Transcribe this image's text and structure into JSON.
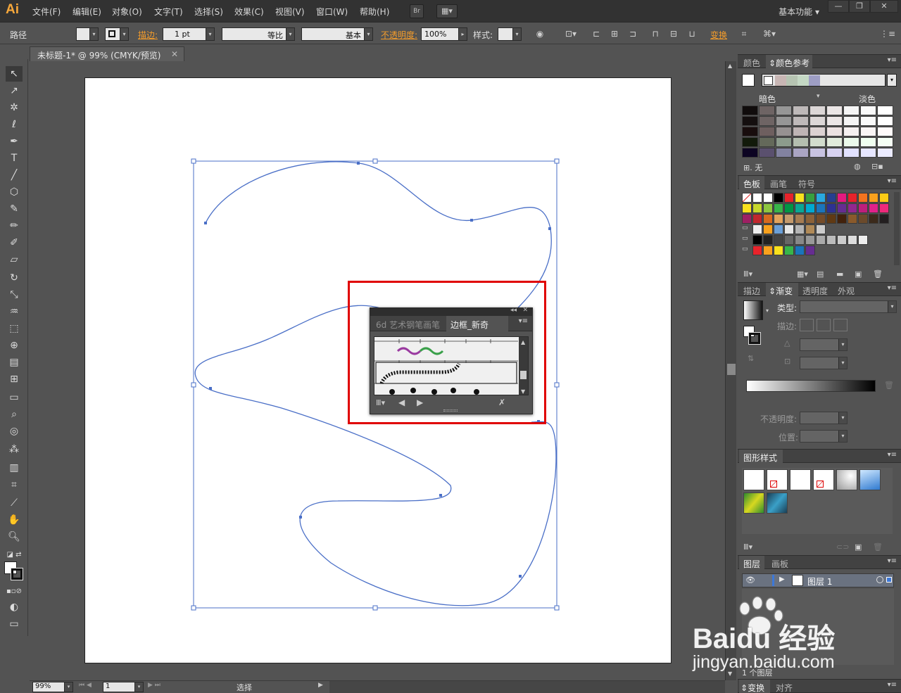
{
  "app": {
    "logo": "Ai"
  },
  "menu": {
    "items": [
      "文件(F)",
      "编辑(E)",
      "对象(O)",
      "文字(T)",
      "选择(S)",
      "效果(C)",
      "视图(V)",
      "窗口(W)",
      "帮助(H)"
    ],
    "bridge_label": "Br",
    "workspace": "基本功能"
  },
  "control_bar": {
    "selection_type": "路径",
    "stroke_label": "描边:",
    "stroke_weight": "1 pt",
    "profile": "等比",
    "brush": "基本",
    "opacity_label": "不透明度:",
    "opacity_value": "100%",
    "style_label": "样式:",
    "transform_label": "变换"
  },
  "document": {
    "tab_title": "未标题-1* @ 99% (CMYK/预览)",
    "close_glyph": "✕"
  },
  "status_bar": {
    "zoom": "99%",
    "artboard_number": "1",
    "tool_status": "选择"
  },
  "panels": {
    "color_tabs": [
      "颜色",
      "颜色参考"
    ],
    "color_guide": {
      "darker_label": "暗色",
      "lighter_label": "淡色",
      "none_label": "无"
    },
    "swatch_tabs": [
      "色板",
      "画笔",
      "符号"
    ],
    "stroke_tabs": [
      "描边",
      "渐变",
      "透明度",
      "外观"
    ],
    "gradient": {
      "type_label": "类型:",
      "stroke_label": "描边:",
      "opacity_label": "不透明度:",
      "location_label": "位置:"
    },
    "graphic_styles_title": "图形样式",
    "layers_tabs": [
      "图层",
      "画板"
    ],
    "layer_name": "图层 1",
    "layers_count": "1 个图层",
    "bottom_tabs": [
      "变换",
      "对齐"
    ]
  },
  "brush_panel": {
    "tabs": [
      "6d 艺术钢笔画笔",
      "边框_新奇"
    ],
    "active_tab": 1
  },
  "watermark": {
    "brand": "Baidu 经验",
    "url": "jingyan.baidu.com"
  },
  "colors": {
    "menubar_bg": "#323232",
    "ui_bg": "#535353",
    "accent_orange": "#f39c2b",
    "path_blue": "#4a6fc7",
    "highlight_red": "#e00000"
  }
}
